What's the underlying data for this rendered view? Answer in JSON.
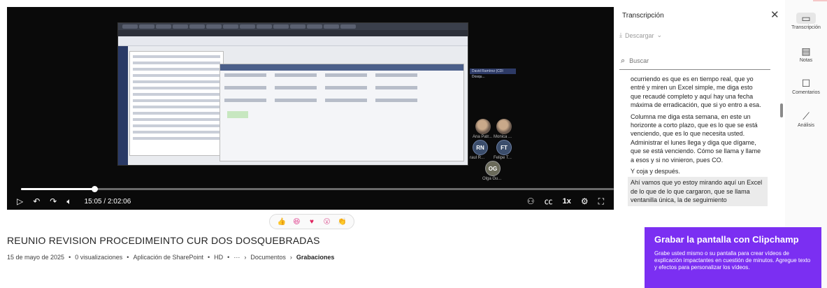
{
  "player": {
    "time_current": "15:05",
    "time_total": "2:02:06",
    "progress_fraction": 0.124,
    "speed_label": "1x",
    "presenter_label": "David Ramírez (CDI Dosqu..."
  },
  "participants": [
    {
      "initials": "",
      "name": "Ana Patr...",
      "type": "photo"
    },
    {
      "initials": "",
      "name": "Monica ...",
      "type": "photo"
    },
    {
      "initials": "RN",
      "name": "raul R...",
      "type": "init"
    },
    {
      "initials": "FT",
      "name": "Felipe T...",
      "type": "init"
    },
    {
      "initials": "OG",
      "name": "Olga Gu...",
      "type": "init2"
    }
  ],
  "video": {
    "title": "REUNIO REVISION PROCEDIMEINTO CUR DOS DOSQUEBRADAS",
    "date": "15 de mayo de 2025",
    "views": "0 visualizaciones",
    "app": "Aplicación de SharePoint",
    "quality": "HD",
    "more": "···",
    "crumb_1": "Documentos",
    "crumb_2": "Grabaciones"
  },
  "reactions": [
    {
      "name": "like-reaction",
      "glyph": "👍",
      "color": "#f4b400"
    },
    {
      "name": "laugh-reaction",
      "glyph": "😆",
      "color": "#e03e8d"
    },
    {
      "name": "heart-reaction",
      "glyph": "♥",
      "color": "#e0245e"
    },
    {
      "name": "surprised-reaction",
      "glyph": "😮",
      "color": "#e06aa0"
    },
    {
      "name": "applause-reaction",
      "glyph": "👏",
      "color": "#f4b400"
    }
  ],
  "transcript": {
    "title": "Transcripción",
    "download_label": "Descargar",
    "search_placeholder": "Buscar",
    "segments": [
      {
        "text": "ocurriendo es que es en tiempo real, que yo entré y miren un Excel simple, me diga esto que recaudé completo y aquí hay una fecha máxima de erradicación, que si yo entro a esa.",
        "highlight": false
      },
      {
        "text": "Columna me diga esta semana, en este un horizonte a corto plazo, que es lo que se está venciendo, que es lo que necesita usted. Administrar el lunes llega y diga que dígame, que se está venciendo. Cómo se llama y llame a esos y si no vinieron, pues CO.",
        "highlight": false
      },
      {
        "text": "Y coja y después.",
        "highlight": false
      },
      {
        "text": "Ahí vamos que yo estoy mirando aquí un Excel de lo que de lo que cargaron, que se llama ventanilla única, la de seguimiento",
        "highlight": true
      }
    ]
  },
  "rail": {
    "transcript_label": "Transcripción",
    "notes_label": "Notas",
    "comments_label": "Comentarios",
    "analytics_label": "Análisis"
  },
  "promo": {
    "title": "Grabar la pantalla con Clipchamp",
    "body": "Grabe usted mismo o su pantalla para crear vídeos de explicación impactantes en cuestión de minutos. Agregue texto y efectos para personalizar los vídeos."
  }
}
